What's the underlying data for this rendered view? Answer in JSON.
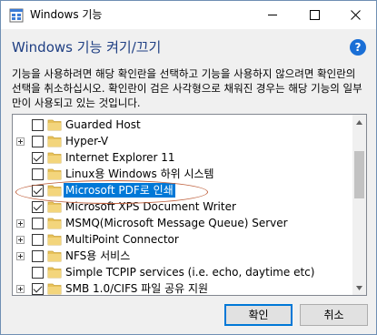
{
  "window": {
    "title": "Windows 기능",
    "controls": {
      "minimize": "—",
      "maximize": "☐",
      "close": "✕"
    }
  },
  "header": {
    "title": "Windows 기능 켜기/끄기",
    "help_label": "?",
    "description": "기능을 사용하려면 해당 확인란을 선택하고 기능을 사용하지 않으려면 확인란의 선택을 취소하십시오. 확인란이 검은 사각형으로 채워진 경우는 해당 기능의 일부만이 사용되고 있는 것입니다."
  },
  "features": [
    {
      "label": "Guarded Host",
      "checked": false,
      "expandable": false,
      "selected": false
    },
    {
      "label": "Hyper-V",
      "checked": false,
      "expandable": true,
      "selected": false
    },
    {
      "label": "Internet Explorer 11",
      "checked": true,
      "expandable": false,
      "selected": false
    },
    {
      "label": "Linux용 Windows 하위 시스템",
      "checked": false,
      "expandable": false,
      "selected": false
    },
    {
      "label": "Microsoft PDF로 인쇄",
      "checked": true,
      "expandable": false,
      "selected": true
    },
    {
      "label": "Microsoft XPS Document Writer",
      "checked": true,
      "expandable": false,
      "selected": false
    },
    {
      "label": "MSMQ(Microsoft Message Queue) Server",
      "checked": false,
      "expandable": true,
      "selected": false
    },
    {
      "label": "MultiPoint Connector",
      "checked": false,
      "expandable": true,
      "selected": false
    },
    {
      "label": "NFS용 서비스",
      "checked": false,
      "expandable": true,
      "selected": false
    },
    {
      "label": "Simple TCPIP services (i.e. echo, daytime etc)",
      "checked": false,
      "expandable": false,
      "selected": false
    },
    {
      "label": "SMB 1.0/CIFS 파일 공유 지원",
      "checked": true,
      "expandable": true,
      "selected": false
    }
  ],
  "footer": {
    "ok_label": "확인",
    "cancel_label": "취소"
  },
  "colors": {
    "header_title": "#1f3f83",
    "selection": "#0078d7",
    "highlight_ellipse": "#c0623f",
    "folder": "#e8c25a",
    "help": "#1a6fd6"
  }
}
